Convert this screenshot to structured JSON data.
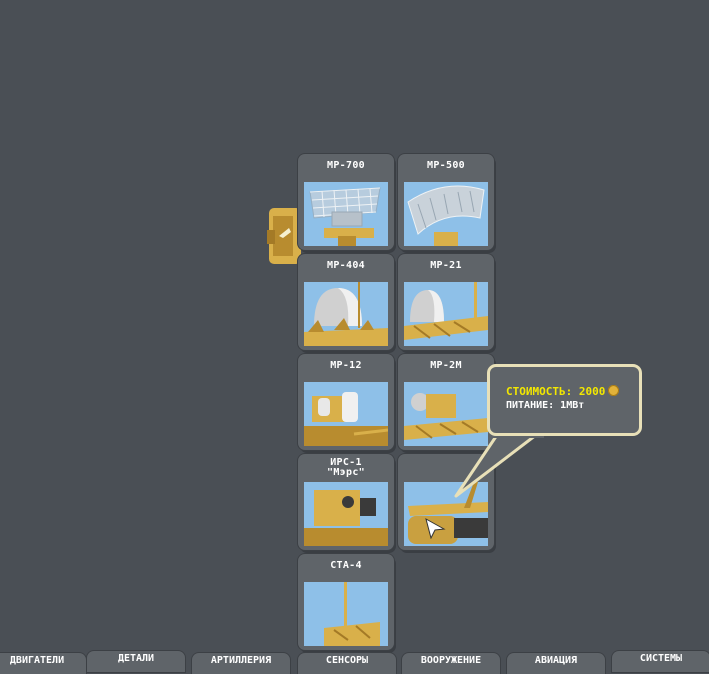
{
  "items": [
    {
      "id": "mp700",
      "name": "МР-700"
    },
    {
      "id": "mp500",
      "name": "МР-500"
    },
    {
      "id": "mp404",
      "name": "МР-404"
    },
    {
      "id": "mp21",
      "name": "МР-21"
    },
    {
      "id": "mp12",
      "name": "МР-12"
    },
    {
      "id": "mp2m",
      "name": "МР-2М"
    },
    {
      "id": "irs1",
      "name": "ИРС-1\n\"Мэрс\""
    },
    {
      "id": "unnamed",
      "name": ""
    },
    {
      "id": "cta4",
      "name": "СТА-4"
    }
  ],
  "tooltip": {
    "cost_label": "СТОИМОСТЬ: 2000",
    "power_label": "ПИТАНИЕ: 1МВт"
  },
  "tabs": [
    {
      "label": "ДВИГАТЕЛИ"
    },
    {
      "label": "ДЕТАЛИ"
    },
    {
      "label": "АРТИЛЛЕРИЯ"
    },
    {
      "label": "СЕНСОРЫ"
    },
    {
      "label": "ВООРУЖЕНИЕ"
    },
    {
      "label": "АВИАЦИЯ"
    },
    {
      "label": "СИСТЕМЫ"
    }
  ],
  "colors": {
    "background": "#4a4f55",
    "card": "#5f6469",
    "sky": "#8ec0e8",
    "ochre": "#d9b04a",
    "cost_text": "#f3e800"
  }
}
